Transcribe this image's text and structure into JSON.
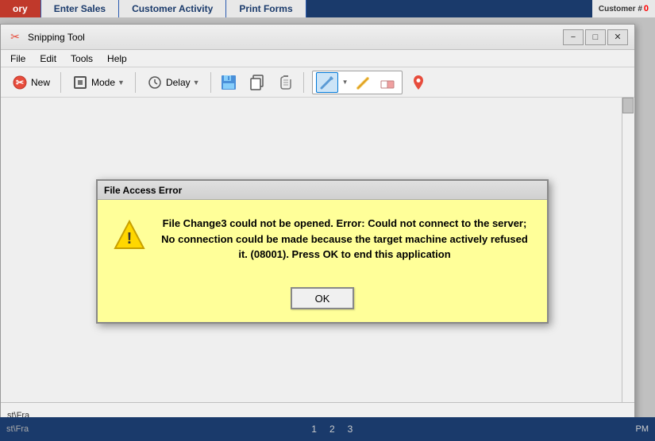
{
  "taskbar": {
    "tabs": [
      {
        "label": "ory",
        "type": "red"
      },
      {
        "label": "Enter Sales",
        "type": "blue-active"
      },
      {
        "label": "Customer Activity",
        "type": "light"
      },
      {
        "label": "Print Forms",
        "type": "light"
      },
      {
        "label": "Customer: 0",
        "type": "counter"
      }
    ]
  },
  "snipping_tool": {
    "title": "Snipping Tool",
    "menu": [
      "File",
      "Edit",
      "Tools",
      "Help"
    ],
    "toolbar": {
      "new_label": "New",
      "mode_label": "Mode",
      "delay_label": "Delay"
    }
  },
  "dialog": {
    "title": "File Access Error",
    "message": "File Change3 could not be opened.  Error: Could not connect to the server; No connection could be made because the target machine actively refused it. (08001).  Press OK to end this application",
    "ok_label": "OK"
  },
  "statusbar": {
    "path": "st\\Fra"
  },
  "bottom_taskbar": {
    "time": "PM",
    "pages": [
      "1",
      "2",
      "3"
    ]
  }
}
